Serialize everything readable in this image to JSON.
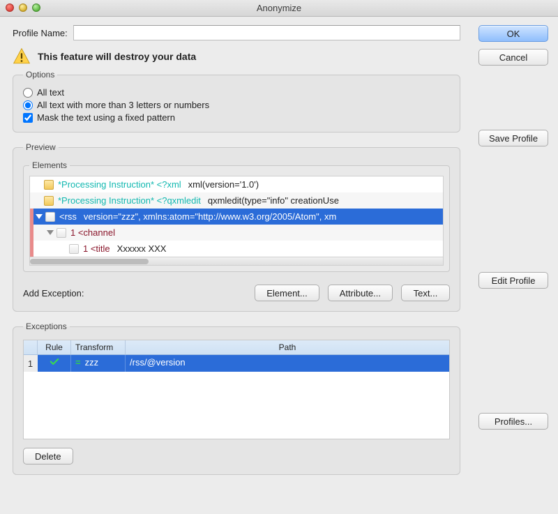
{
  "window": {
    "title": "Anonymize"
  },
  "profileName": {
    "label": "Profile Name:",
    "value": ""
  },
  "warning": {
    "text": "This feature will destroy your data"
  },
  "options": {
    "legend": "Options",
    "radio": {
      "allText": {
        "label": "All text",
        "selected": false
      },
      "allTextMin": {
        "label": "All text with more than 3 letters or numbers",
        "selected": true
      }
    },
    "mask": {
      "label": "Mask the text using a fixed pattern",
      "checked": true
    }
  },
  "preview": {
    "legend": "Preview",
    "elementsLegend": "Elements",
    "rows": [
      {
        "kind": "pi",
        "label": "*Processing Instruction* <?xml",
        "detail": "xml(version='1.0')"
      },
      {
        "kind": "pi",
        "label": "*Processing Instruction* <?qxmledit",
        "detail": "qxmledit(type=\"info\"   creationUse"
      },
      {
        "kind": "el",
        "label": "<rss",
        "detail": "version=\"zzz\", xmlns:atom=\"http://www.w3.org/2005/Atom\", xm",
        "selected": true
      },
      {
        "kind": "el",
        "label": "1 <channel",
        "detail": ""
      },
      {
        "kind": "el",
        "label": "1 <title",
        "detail": "Xxxxxx XXX"
      }
    ],
    "addExceptionLabel": "Add Exception:",
    "buttons": {
      "element": "Element...",
      "attribute": "Attribute...",
      "text": "Text..."
    }
  },
  "exceptions": {
    "legend": "Exceptions",
    "columns": {
      "rule": "Rule",
      "transform": "Transform",
      "path": "Path"
    },
    "rows": [
      {
        "index": "1",
        "rule": "check",
        "transform": "zzz",
        "path": "/rss/@version",
        "selected": true
      }
    ],
    "deleteLabel": "Delete"
  },
  "sideButtons": {
    "ok": "OK",
    "cancel": "Cancel",
    "saveProfile": "Save Profile",
    "editProfile": "Edit Profile",
    "profiles": "Profiles..."
  }
}
